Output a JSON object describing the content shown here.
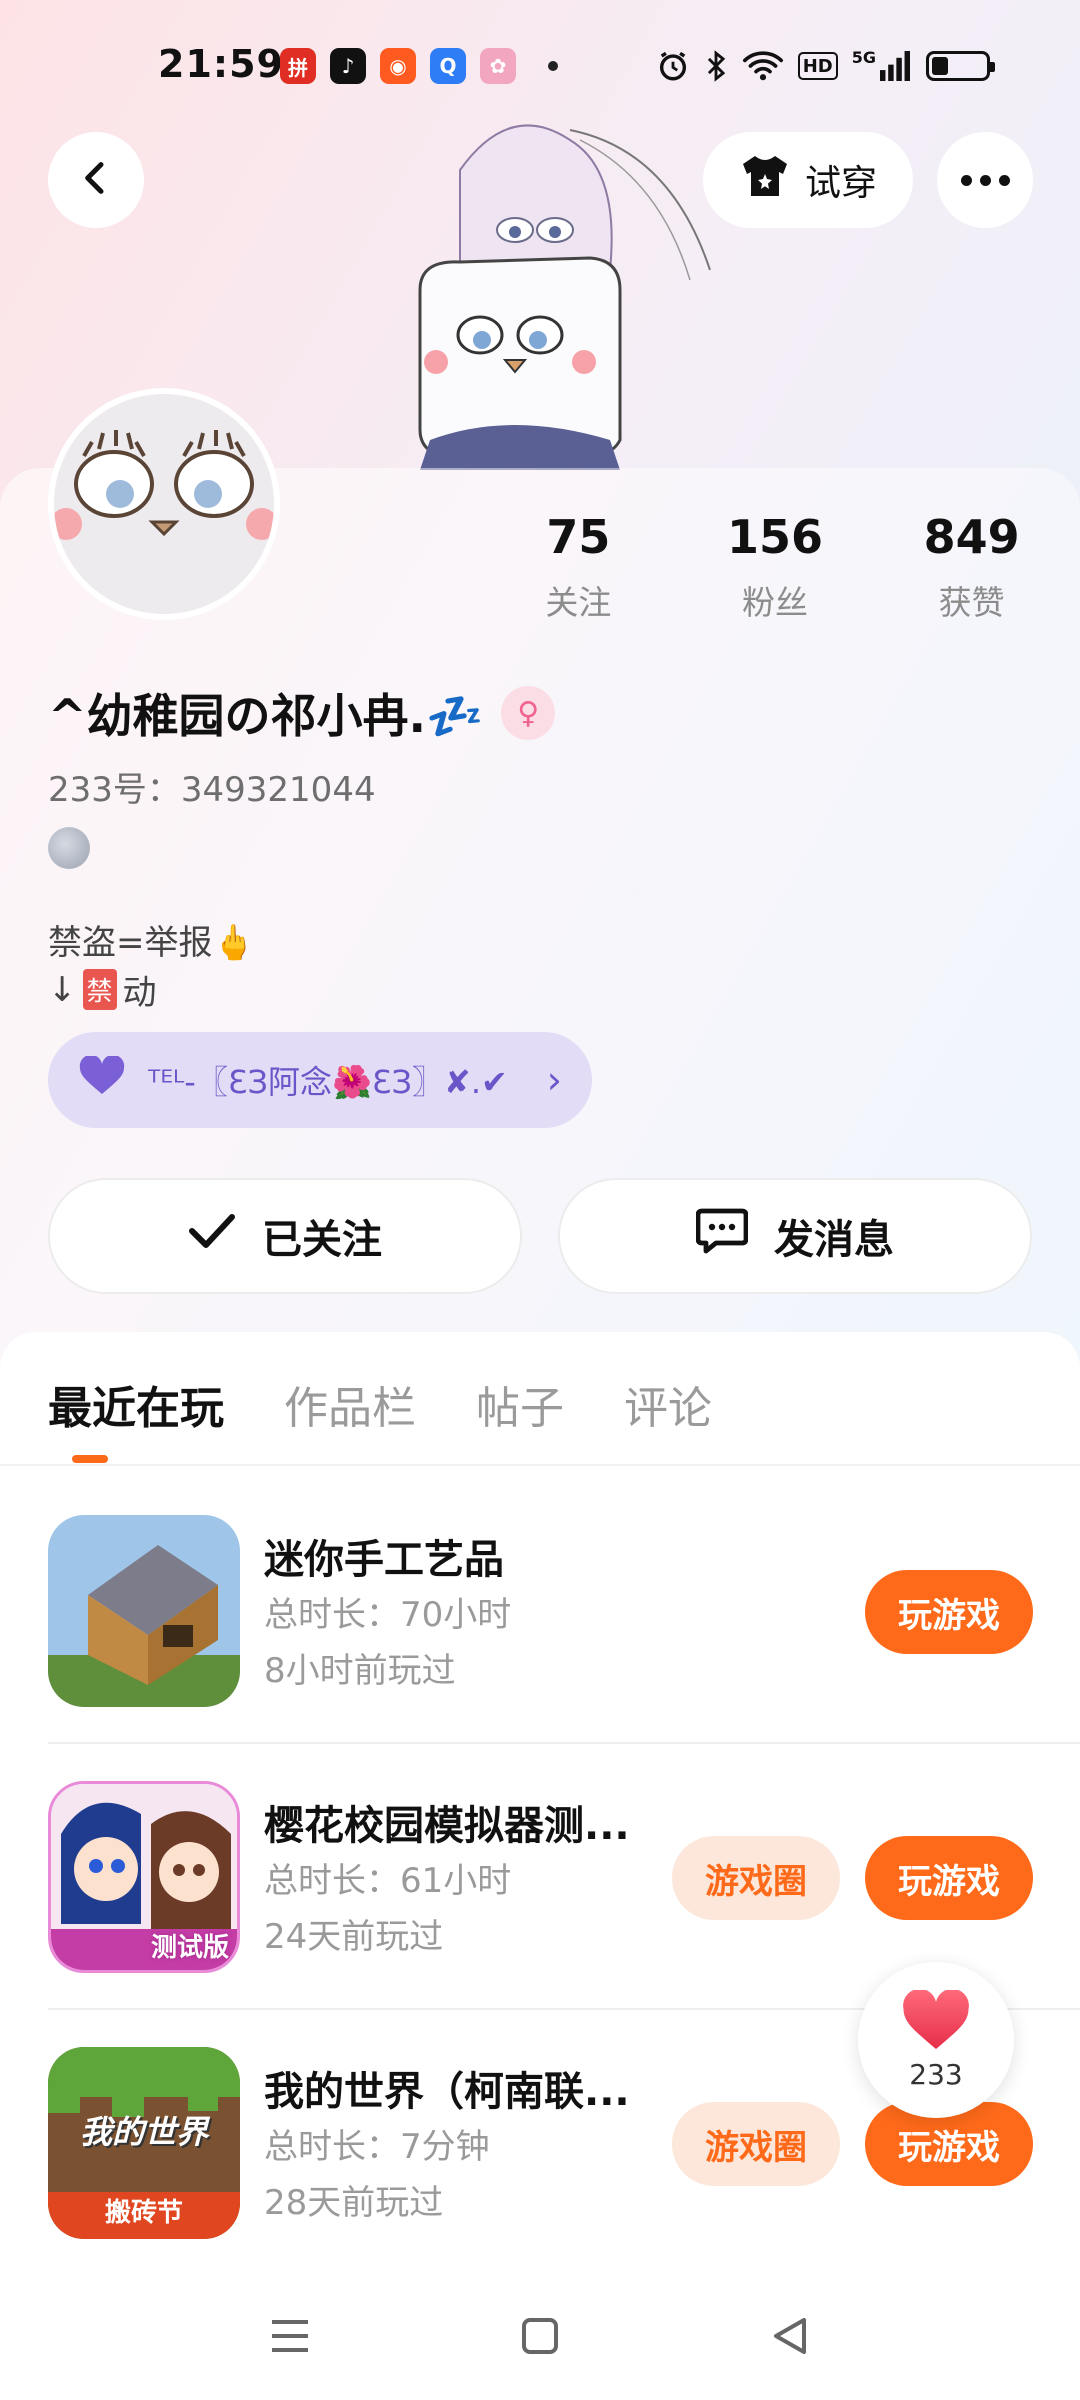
{
  "status_bar": {
    "time": "21:59",
    "signal_label": "5G",
    "hd_label": "HD",
    "battery_level": 0.3,
    "apps": [
      {
        "name": "pinduoduo-icon",
        "color": "#e02e24",
        "glyph": "拼"
      },
      {
        "name": "tiktok-icon",
        "color": "#111111",
        "glyph": "♪"
      },
      {
        "name": "weibo-icon",
        "color": "#ff5a1f",
        "glyph": "◉"
      },
      {
        "name": "browser-icon",
        "color": "#2f7df6",
        "glyph": "Q"
      },
      {
        "name": "game-app-icon",
        "color": "#f3a6c0",
        "glyph": "✿"
      }
    ]
  },
  "header": {
    "try_on_label": "试穿"
  },
  "profile": {
    "stats": [
      {
        "num": "75",
        "label": "关注"
      },
      {
        "num": "156",
        "label": "粉丝"
      },
      {
        "num": "849",
        "label": "获赞"
      }
    ],
    "username": "^幼稚园の祁小冉.💤",
    "uid": "233号：349321044",
    "bio_line1": "禁盗=举报🖕",
    "bio_line2_prefix": "↓",
    "bio_line2_badge": "禁",
    "bio_line2_suffix": "动",
    "fan_badge_text": "ᵀᴱᴸ-〖ƐЗ阿念🌺ƐЗ〗✘.✔",
    "follow_label": "已关注",
    "message_label": "发消息"
  },
  "tabs": [
    "最近在玩",
    "作品栏",
    "帖子",
    "评论"
  ],
  "games": [
    {
      "title": "迷你手工艺品",
      "duration": "总时长：70小时",
      "last_played": "8小时前玩过",
      "play_label": "玩游戏",
      "circle_label": ""
    },
    {
      "title": "樱花校园模拟器测...",
      "duration": "总时长：61小时",
      "last_played": "24天前玩过",
      "play_label": "玩游戏",
      "circle_label": "游戏圈",
      "icon_badge": "测试版"
    },
    {
      "title": "我的世界（柯南联...",
      "duration": "总时长：7分钟",
      "last_played": "28天前玩过",
      "play_label": "玩游戏",
      "circle_label": "游戏圈",
      "icon_title": "我的世界",
      "icon_badge": "搬砖节"
    }
  ],
  "like_float": {
    "count": "233"
  },
  "colors": {
    "accent": "#ff6a1a",
    "accent_soft": "#fde7da",
    "badge_purple": "#6a56c8"
  }
}
